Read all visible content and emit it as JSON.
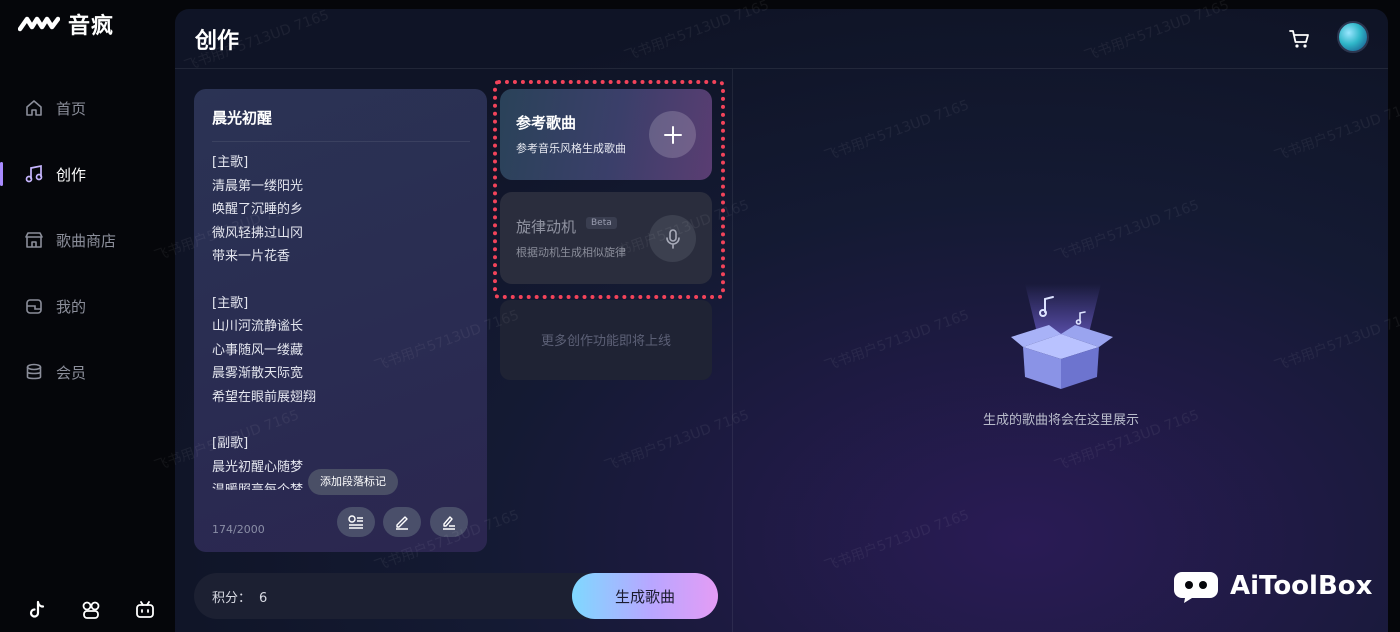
{
  "app": {
    "name": "音疯"
  },
  "sidebar": {
    "items": [
      {
        "label": "首页",
        "icon": "home-icon"
      },
      {
        "label": "创作",
        "icon": "music-note-icon",
        "active": true
      },
      {
        "label": "歌曲商店",
        "icon": "store-icon"
      },
      {
        "label": "我的",
        "icon": "folder-icon"
      },
      {
        "label": "会员",
        "icon": "database-icon"
      }
    ],
    "social_icons": [
      "tiktok-icon",
      "app-icon",
      "bilibili-icon"
    ]
  },
  "header": {
    "title": "创作"
  },
  "lyrics": {
    "title": "晨光初醒",
    "blocks": [
      {
        "tag": "[主歌]",
        "lines": [
          "清晨第一缕阳光",
          "唤醒了沉睡的乡",
          "微风轻拂过山冈",
          "带来一片花香"
        ]
      },
      {
        "tag": "[主歌]",
        "lines": [
          "山川河流静谧长",
          "心事随风一缕藏",
          "晨雾渐散天际宽",
          "希望在眼前展翅翔"
        ]
      },
      {
        "tag": "[副歌]",
        "lines": [
          "晨光初醒心随梦",
          "温暖照亮每个梦"
        ]
      }
    ],
    "char_count": "174/2000",
    "tooltip": "添加段落标记"
  },
  "features": {
    "reference": {
      "title": "参考歌曲",
      "subtitle": "参考音乐风格生成歌曲"
    },
    "melody": {
      "title": "旋律动机",
      "badge": "Beta",
      "subtitle": "根据动机生成相似旋律"
    },
    "more": "更多创作功能即将上线"
  },
  "bottom": {
    "points_label": "积分：",
    "points_value": "6",
    "generate_label": "生成歌曲"
  },
  "result": {
    "empty_text": "生成的歌曲将会在这里展示"
  },
  "watermark": "飞书用户5713UD 7165",
  "brand": {
    "name": "AiToolBox"
  },
  "colors": {
    "accent": "#a98bff",
    "highlight": "#f2435a",
    "button_from": "#7fd8ff",
    "button_to": "#e49cf5"
  }
}
